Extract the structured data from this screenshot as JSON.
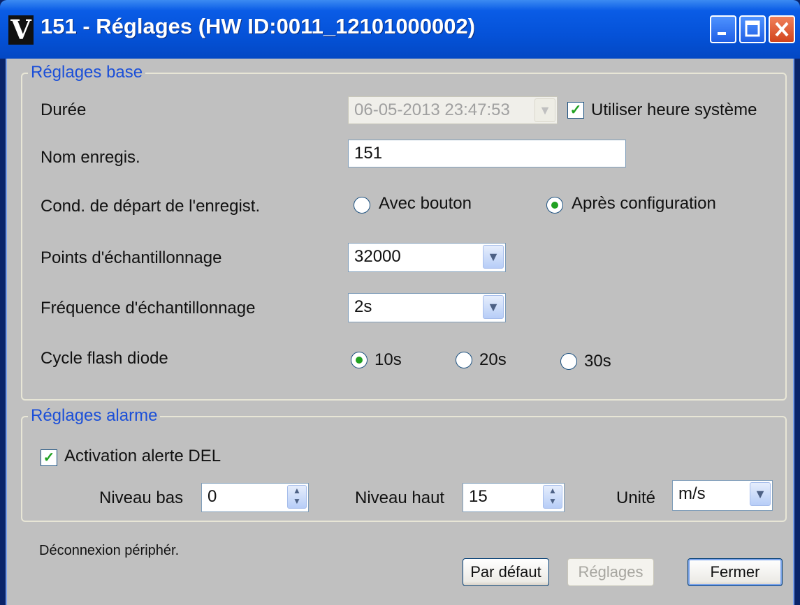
{
  "window": {
    "icon_glyph": "V",
    "title": "151 - Réglages (HW ID:0011_12101000002)",
    "controls": [
      "minimize-icon",
      "maximize-icon",
      "close-icon"
    ]
  },
  "base": {
    "legend": "Réglages base",
    "duration_label": "Durée",
    "duration_value": "06-05-2013 23:47:53",
    "use_system_time_label": "Utiliser heure système",
    "use_system_time_checked": true,
    "name_label": "Nom enregis.",
    "name_value": "151",
    "start_label": "Cond. de départ de l'enregist.",
    "start_options": [
      "Avec bouton",
      "Après configuration"
    ],
    "start_selected": "Après configuration",
    "points_label": "Points d'échantillonnage",
    "points_value": "32000",
    "freq_label": "Fréquence d'échantillonnage",
    "freq_value": "2s",
    "flash_label": "Cycle flash diode",
    "flash_options": [
      "10s",
      "20s",
      "30s"
    ],
    "flash_selected": "10s"
  },
  "alarm": {
    "legend": "Réglages alarme",
    "led_label": "Activation alerte DEL",
    "led_checked": true,
    "low_label": "Niveau bas",
    "low_value": "0",
    "high_label": "Niveau haut",
    "high_value": "15",
    "unit_label": "Unité",
    "unit_value": "m/s"
  },
  "status_text": "Déconnexion périphér.",
  "buttons": {
    "default": "Par défaut",
    "apply": "Réglages",
    "close": "Fermer"
  },
  "colors": {
    "title_bar": "#0552D8",
    "group_legend": "#1B4FD8",
    "check_mark": "#21A121"
  }
}
